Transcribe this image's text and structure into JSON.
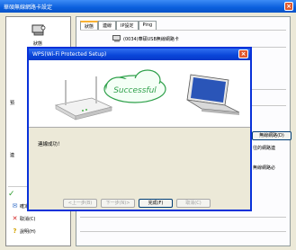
{
  "outer_window": {
    "title": "華碩無線網路卡設定",
    "close_symbol": "×"
  },
  "left_panel": {
    "top_label": "狀態",
    "side_labels": [
      "預",
      "連"
    ],
    "ok_label": "確定(O)",
    "cancel_label": "取消(C)",
    "help_label": "說明(H)"
  },
  "right_panel": {
    "tabs": [
      {
        "label": "狀態"
      },
      {
        "label": "連線"
      },
      {
        "label": "IP設定"
      },
      {
        "label": "Ping"
      }
    ],
    "adapter_text": "(0034)華碩USB無線網路卡",
    "scan_button": "無線網路(D)",
    "text_line_1": "往的網路連",
    "text_line_2": "無線網路必"
  },
  "wps_dialog": {
    "title": "WPS(Wi-Fi Protected Setup)",
    "close_symbol": "×",
    "banner_text": "Successful",
    "message": "連線成功！",
    "buttons": [
      {
        "label": "<上一步(B)",
        "enabled": false
      },
      {
        "label": "下一步(N)>",
        "enabled": false
      },
      {
        "label": "完成(F)",
        "enabled": true
      },
      {
        "label": "取消(C)",
        "enabled": false
      }
    ]
  },
  "icons": [
    "router-icon",
    "cloud-icon",
    "laptop-icon",
    "ok-check-icon",
    "cancel-x-icon",
    "help-icon",
    "network-adapter-icon"
  ]
}
